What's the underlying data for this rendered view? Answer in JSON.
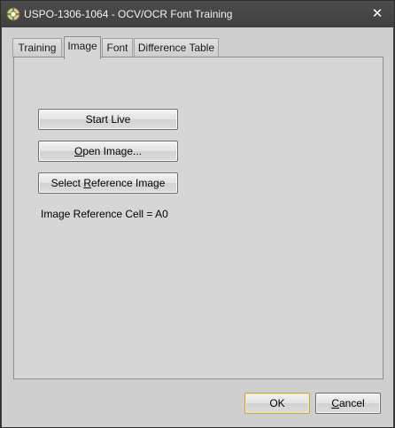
{
  "window": {
    "title": "USPO-1306-1064 - OCV/OCR Font Training",
    "close_glyph": "✕"
  },
  "tabs": [
    {
      "label": "Training",
      "active": false
    },
    {
      "label": "Image",
      "active": true
    },
    {
      "label": "Font",
      "active": false
    },
    {
      "label": "Difference Table",
      "active": false
    }
  ],
  "image_tab": {
    "start_live": "Start Live",
    "open_image_pre": "",
    "open_image_mnemonic": "O",
    "open_image_post": "pen Image...",
    "select_ref_pre": "Select ",
    "select_ref_mnemonic": "R",
    "select_ref_post": "eference Image",
    "reference_cell": "Image Reference Cell = A0"
  },
  "dialog": {
    "ok": "OK",
    "cancel_mnemonic": "C",
    "cancel_post": "ancel"
  },
  "colors": {
    "titlebar": "#444444",
    "client": "#cfcfcf",
    "ok_border": "#c9a24a"
  }
}
